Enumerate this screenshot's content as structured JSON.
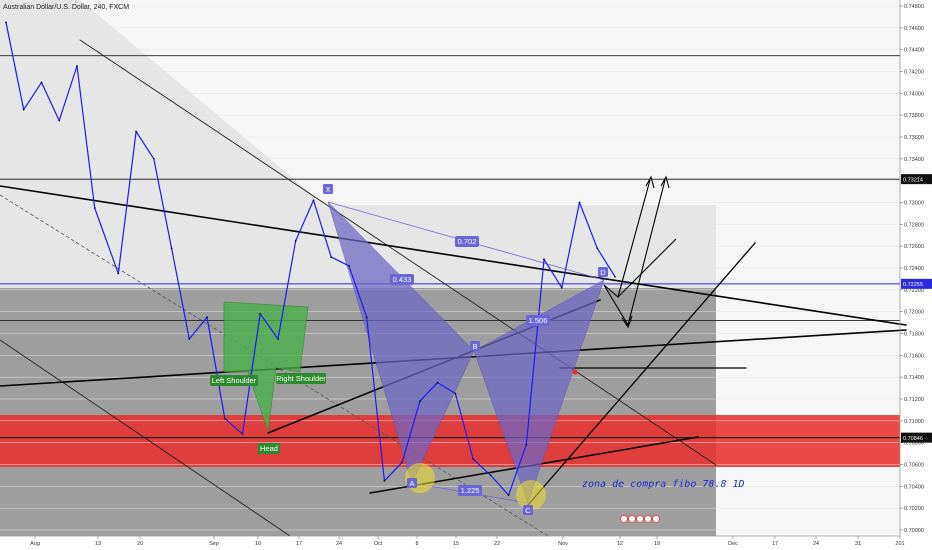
{
  "chart_data": {
    "type": "line",
    "title": "Australian Dollar/U.S. Dollar, 240, FXCM",
    "symbol": "AUDUSD",
    "timeframe": "240",
    "source": "FXCM",
    "xlabel": "",
    "ylabel": "",
    "x_ticks": [
      "Aug",
      "13",
      "20",
      "Sep",
      "10",
      "17",
      "24",
      "Oct",
      "8",
      "15",
      "22",
      "Nov",
      "12",
      "19",
      "Dec",
      "17",
      "24",
      "31",
      "201"
    ],
    "y_ticks": [
      "0.74800",
      "0.74600",
      "0.74400",
      "0.74200",
      "0.74000",
      "0.73800",
      "0.73600",
      "0.73400",
      "0.73200",
      "0.73000",
      "0.72800",
      "0.72600",
      "0.72400",
      "0.72200",
      "0.72000",
      "0.71800",
      "0.71600",
      "0.71400",
      "0.71200",
      "0.71000",
      "0.70800",
      "0.70600",
      "0.70400",
      "0.70200",
      "0.70000"
    ],
    "ylim": [
      0.6996,
      0.7489
    ],
    "grid": true,
    "series": [
      {
        "name": "",
        "x": [
          "Aug 1",
          "Aug 4",
          "Aug 7",
          "Aug 10",
          "Aug 13",
          "Aug 16",
          "Aug 20",
          "Aug 23",
          "Aug 26",
          "Aug 29",
          "Sep 1",
          "Sep 4",
          "Sep 7",
          "Sep 10",
          "Sep 13",
          "Sep 16",
          "Sep 19",
          "Sep 22",
          "Sep 25",
          "Sep 28",
          "Oct 1",
          "Oct 4",
          "Oct 7",
          "Oct 10",
          "Oct 13",
          "Oct 16",
          "Oct 19",
          "Oct 22",
          "Oct 25",
          "Oct 28",
          "Oct 31",
          "Nov 3",
          "Nov 6",
          "Nov 9",
          "Nov 12"
        ],
        "values": [
          0.7465,
          0.7385,
          0.741,
          0.7375,
          0.7425,
          0.7295,
          0.7235,
          0.7365,
          0.734,
          0.7258,
          0.7175,
          0.7195,
          0.7102,
          0.7088,
          0.7198,
          0.7175,
          0.7265,
          0.7302,
          0.725,
          0.7242,
          0.7195,
          0.7045,
          0.7062,
          0.7118,
          0.7135,
          0.7125,
          0.7065,
          0.705,
          0.7032,
          0.7078,
          0.7248,
          0.7222,
          0.73,
          0.7258,
          0.7232
        ]
      }
    ],
    "horizontal_levels": [
      {
        "price": 0.74345,
        "label": ""
      },
      {
        "price": 0.73214,
        "label": "0.73214"
      },
      {
        "price": 0.72255,
        "label": "0.72255"
      },
      {
        "price": 0.70846,
        "label": "0.70846"
      },
      {
        "price": 0.7192,
        "label": ""
      }
    ],
    "zones": [
      {
        "from": 0.7059,
        "to": 0.7107,
        "color": "#e8312f",
        "label": ""
      },
      {
        "from": 0.6996,
        "to": 0.7222,
        "color": "#7f7f7f",
        "label": ""
      }
    ],
    "pattern_points": {
      "X": 0.7302,
      "A": 0.7042,
      "B": 0.7162,
      "C": 0.7027,
      "D": 0.7248
    },
    "fib_ratios": [
      "0.702",
      "0.433",
      "1.506",
      "1.225"
    ],
    "head_and_shoulders": [
      "Left Shoulder",
      "Head",
      "Right Shoulder"
    ],
    "annotation": "zona de compra fibo 78.8 1D",
    "colors": {
      "price_line": "#1a1aff",
      "bat_fill": "#7a74c8",
      "hs_fill": "#4fb34f",
      "zone_text": "#1f2dcc"
    }
  }
}
